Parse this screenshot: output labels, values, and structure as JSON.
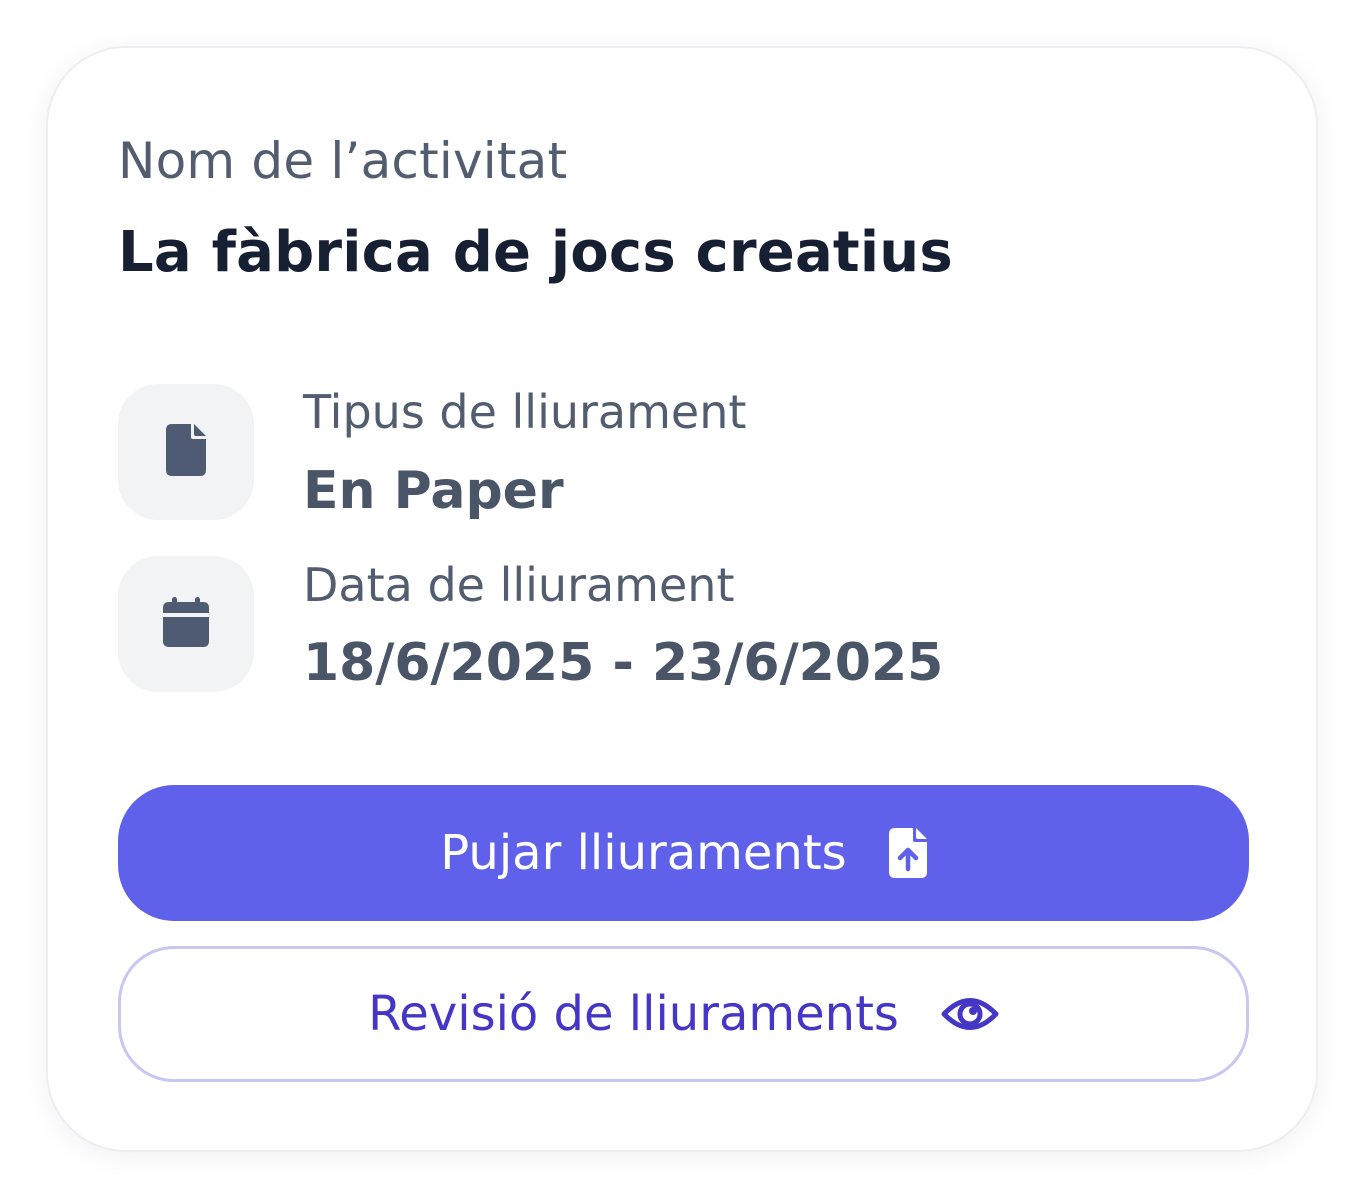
{
  "activity": {
    "label": "Nom de l’activitat",
    "name": "La fàbrica de jocs creatius"
  },
  "delivery_type": {
    "icon": "file-icon",
    "label": "Tipus de lliurament",
    "value": "En Paper"
  },
  "delivery_date": {
    "icon": "calendar-icon",
    "label": "Data de lliurament",
    "value": "18/6/2025 - 23/6/2025"
  },
  "actions": {
    "upload_label": "Pujar lliuraments",
    "upload_icon": "file-upload-icon",
    "review_label": "Revisió de lliuraments",
    "review_icon": "eye-icon"
  },
  "colors": {
    "primary": "#5f61ea",
    "secondary_text": "#4536c7",
    "secondary_border": "#c9c6f1",
    "icon": "#4f5b72"
  }
}
